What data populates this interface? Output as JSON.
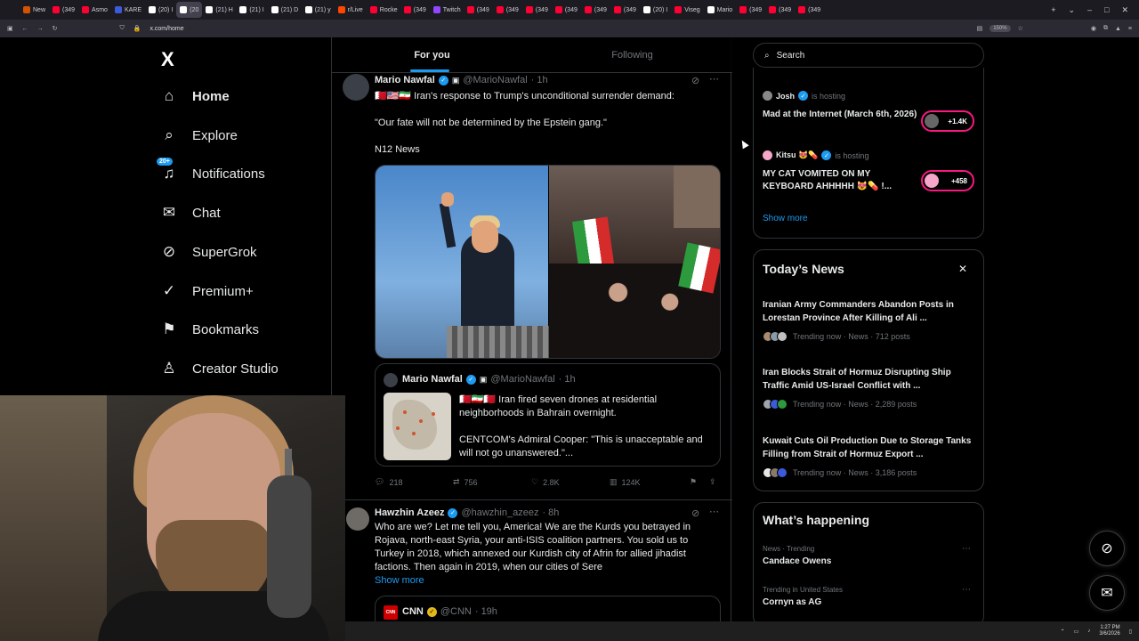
{
  "browser": {
    "tabs": [
      {
        "label": "New",
        "color": "#d35400"
      },
      {
        "label": "(349",
        "color": "#ff0033"
      },
      {
        "label": "Asmo",
        "color": "#ff0033"
      },
      {
        "label": "KARE",
        "color": "#3b5bdb"
      },
      {
        "label": "(20) I",
        "color": "#ffffff"
      },
      {
        "label": "(20",
        "color": "#ffffff",
        "active": true
      },
      {
        "label": "(21) H",
        "color": "#ffffff"
      },
      {
        "label": "(21) I",
        "color": "#ffffff"
      },
      {
        "label": "(21) D",
        "color": "#ffffff"
      },
      {
        "label": "(21) y",
        "color": "#ffffff"
      },
      {
        "label": "r/Live",
        "color": "#ff4500"
      },
      {
        "label": "Rocke",
        "color": "#ff0033"
      },
      {
        "label": "(349",
        "color": "#ff0033"
      },
      {
        "label": "Twitch",
        "color": "#9146ff"
      },
      {
        "label": "(349",
        "color": "#ff0033"
      },
      {
        "label": "(349",
        "color": "#ff0033"
      },
      {
        "label": "(349",
        "color": "#ff0033"
      },
      {
        "label": "(349",
        "color": "#ff0033"
      },
      {
        "label": "(349",
        "color": "#ff0033"
      },
      {
        "label": "(349",
        "color": "#ff0033"
      },
      {
        "label": "(20) I",
        "color": "#ffffff"
      },
      {
        "label": "Viseg",
        "color": "#ff0033"
      },
      {
        "label": "Mario",
        "color": "#ffffff"
      },
      {
        "label": "(349",
        "color": "#ff0033"
      },
      {
        "label": "(349",
        "color": "#ff0033"
      },
      {
        "label": "(349",
        "color": "#ff0033"
      }
    ],
    "url": "x.com/home",
    "zoom": "150%"
  },
  "nav": {
    "logo": "X",
    "items": [
      {
        "label": "Home",
        "icon": "home-icon",
        "glyph": "⌂"
      },
      {
        "label": "Explore",
        "icon": "search-icon",
        "glyph": "⌕"
      },
      {
        "label": "Notifications",
        "icon": "bell-icon",
        "glyph": "🔔",
        "badge": "20+"
      },
      {
        "label": "Chat",
        "icon": "mail-icon",
        "glyph": "✉"
      },
      {
        "label": "SuperGrok",
        "icon": "grok-icon",
        "glyph": "⊘"
      },
      {
        "label": "Premium+",
        "icon": "premium-icon",
        "glyph": "✓"
      },
      {
        "label": "Bookmarks",
        "icon": "bookmark-icon",
        "glyph": "🔖"
      },
      {
        "label": "Creator Studio",
        "icon": "creator-icon",
        "glyph": "♙"
      }
    ]
  },
  "feed": {
    "tabs": [
      "For you",
      "Following"
    ],
    "tweet1": {
      "name": "Mario Nawfal",
      "handle": "@MarioNawfal",
      "time": "· 1h",
      "line1": "🇧🇭🇺🇸🇮🇷 Iran's response to Trump's unconditional surrender demand:",
      "line2": "\"Our fate will not be determined by the Epstein gang.\"",
      "line3": "N12 News",
      "quote": {
        "name": "Mario Nawfal",
        "handle": "@MarioNawfal",
        "time": "· 1h",
        "text1": "🇧🇭🇮🇷🇧🇭 Iran fired seven drones at residential neighborhoods in Bahrain overnight.",
        "text2": "CENTCOM's Admiral Cooper: \"This is unacceptable and will not go unanswered.\"..."
      },
      "stats": {
        "replies": "218",
        "reposts": "756",
        "likes": "2.8K",
        "views": "124K"
      }
    },
    "tweet2": {
      "name": "Hawzhin Azeez",
      "handle": "@hawzhin_azeez",
      "time": "· 8h",
      "text": "Who are we? Let me tell you, America! We are the Kurds you betrayed in Rojava, north-east Syria, your anti-ISIS coalition partners. You sold us to Turkey in 2018, which annexed our Kurdish city of Afrin for allied jihadist factions. Then again in 2019, when our cities of Sere",
      "show_more": "Show more"
    },
    "tweet3": {
      "name": "CNN",
      "handle": "@CNN",
      "time": "· 19h"
    }
  },
  "sidebar": {
    "search_placeholder": "Search",
    "spaces": [
      {
        "host": "Josh",
        "status": "is hosting",
        "title": "Mad at the Internet (March 6th, 2026)",
        "listeners": "+1.4K"
      },
      {
        "host": "Kitsu 😻💊",
        "status": "is hosting",
        "title": "MY CAT VOMITED ON MY KEYBOARD AHHHHH 😻💊 !...",
        "listeners": "+458"
      }
    ],
    "spaces_show_more": "Show more",
    "news": {
      "title": "Today’s News",
      "items": [
        {
          "title": "Iranian Army Commanders Abandon Posts in Lorestan Province After Killing of Ali ...",
          "meta": "Trending now · News · 712 posts"
        },
        {
          "title": "Iran Blocks Strait of Hormuz Disrupting Ship Traffic Amid US-Israel Conflict with ...",
          "meta": "Trending now · News · 2,289 posts"
        },
        {
          "title": "Kuwait Cuts Oil Production Due to Storage Tanks Filling from Strait of Hormuz Export ...",
          "meta": "Trending now · News · 3,186 posts"
        }
      ]
    },
    "happening": {
      "title": "What’s happening",
      "items": [
        {
          "category": "News · Trending",
          "name": "Candace Owens"
        },
        {
          "category": "Trending in United States",
          "name": "Cornyn as AG"
        }
      ]
    }
  },
  "taskbar": {
    "time": "1:27 PM",
    "date": "3/6/2026"
  },
  "colors": {
    "accent": "#1d9bf0",
    "live": "#f91880",
    "bg": "#000000",
    "muted": "#71767b"
  }
}
